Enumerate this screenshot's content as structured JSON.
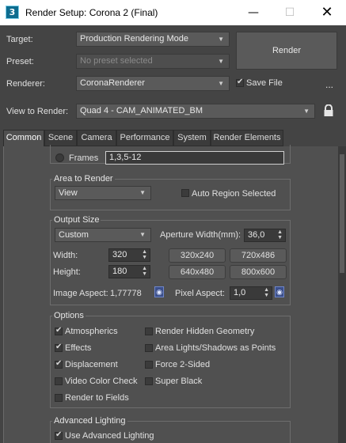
{
  "window": {
    "title": "Render Setup: Corona 2 (Final)",
    "app_icon_glyph": "3",
    "minimize_glyph": "—",
    "maximize_glyph": "☐",
    "close_glyph": "✕"
  },
  "header": {
    "target_label": "Target:",
    "target_value": "Production Rendering Mode",
    "preset_label": "Preset:",
    "preset_value": "No preset selected",
    "renderer_label": "Renderer:",
    "renderer_value": "CoronaRenderer",
    "save_file_label": "Save File",
    "save_file_checked": true,
    "more_label": "...",
    "view_label": "View to Render:",
    "view_value": "Quad 4 - CAM_ANIMATED_BM",
    "render_button": "Render"
  },
  "tabs": [
    "Common",
    "Scene",
    "Camera",
    "Performance",
    "System",
    "Render Elements"
  ],
  "active_tab": "Common",
  "frames": {
    "label": "Frames",
    "value": "1,3,5-12"
  },
  "area_to_render": {
    "title": "Area to Render",
    "mode": "View",
    "auto_region_label": "Auto Region Selected"
  },
  "output_size": {
    "title": "Output Size",
    "preset": "Custom",
    "aperture_label": "Aperture Width(mm):",
    "aperture_value": "36,0",
    "width_label": "Width:",
    "width_value": "320",
    "height_label": "Height:",
    "height_value": "180",
    "presets": [
      "320x240",
      "720x486",
      "640x480",
      "800x600"
    ],
    "image_aspect_label": "Image Aspect:",
    "image_aspect_value": "1,77778",
    "pixel_aspect_label": "Pixel Aspect:",
    "pixel_aspect_value": "1,0"
  },
  "options": {
    "title": "Options",
    "left": [
      {
        "label": "Atmospherics",
        "checked": true
      },
      {
        "label": "Effects",
        "checked": true
      },
      {
        "label": "Displacement",
        "checked": true
      },
      {
        "label": "Video Color Check",
        "checked": false
      },
      {
        "label": "Render to Fields",
        "checked": false
      }
    ],
    "right": [
      {
        "label": "Render Hidden Geometry",
        "checked": false
      },
      {
        "label": "Area Lights/Shadows as Points",
        "checked": false
      },
      {
        "label": "Force 2-Sided",
        "checked": false
      },
      {
        "label": "Super Black",
        "checked": false
      }
    ]
  },
  "advanced_lighting": {
    "title": "Advanced Lighting",
    "use_label": "Use Advanced Lighting",
    "use_checked": true
  }
}
